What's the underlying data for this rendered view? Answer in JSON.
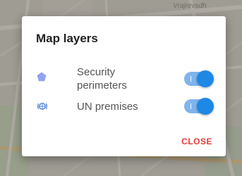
{
  "map": {
    "street_label": "Vrajrevsdh"
  },
  "dialog": {
    "title": "Map layers",
    "layers": [
      {
        "label_line1": "Security",
        "label_line2": "perimeters",
        "icon": "pentagon-icon",
        "enabled": true
      },
      {
        "label": "UN premises",
        "icon": "un-emblem-icon",
        "enabled": true
      }
    ],
    "close_label": "CLOSE"
  },
  "colors": {
    "toggle_track": "#7fb4ee",
    "toggle_knob": "#1e88e5",
    "pentagon_icon": "#8fa3f0",
    "un_icon": "#4a7fd6",
    "close_text": "#e53935"
  }
}
